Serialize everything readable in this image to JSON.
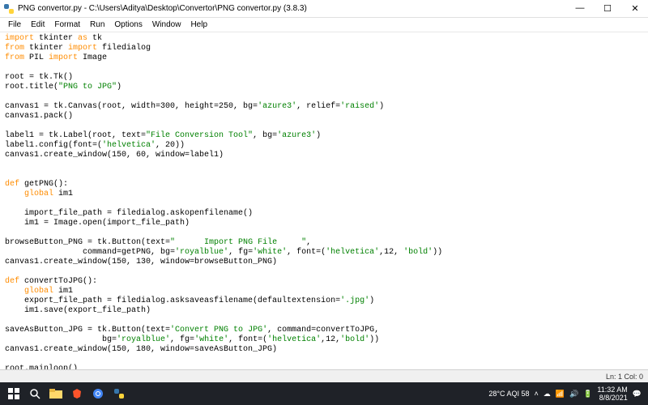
{
  "window": {
    "title": "PNG convertor.py - C:\\Users\\Aditya\\Desktop\\Convertor\\PNG convertor.py (3.8.3)"
  },
  "menu": {
    "file": "File",
    "edit": "Edit",
    "format": "Format",
    "run": "Run",
    "options": "Options",
    "window": "Window",
    "help": "Help"
  },
  "code": {
    "tokens": [
      {
        "t": "import",
        "c": "kw"
      },
      {
        "t": " tkinter "
      },
      {
        "t": "as",
        "c": "kw"
      },
      {
        "t": " tk\n"
      },
      {
        "t": "from",
        "c": "kw"
      },
      {
        "t": " tkinter "
      },
      {
        "t": "import",
        "c": "kw"
      },
      {
        "t": " filedialog\n"
      },
      {
        "t": "from",
        "c": "kw"
      },
      {
        "t": " PIL "
      },
      {
        "t": "import",
        "c": "kw"
      },
      {
        "t": " Image\n"
      },
      {
        "t": "\n"
      },
      {
        "t": "root = tk.Tk()\n"
      },
      {
        "t": "root.title("
      },
      {
        "t": "\"PNG to JPG\"",
        "c": "str"
      },
      {
        "t": ")\n"
      },
      {
        "t": "\n"
      },
      {
        "t": "canvas1 = tk.Canvas(root, width=300, height=250, bg="
      },
      {
        "t": "'azure3'",
        "c": "str"
      },
      {
        "t": ", relief="
      },
      {
        "t": "'raised'",
        "c": "str"
      },
      {
        "t": ")\n"
      },
      {
        "t": "canvas1.pack()\n"
      },
      {
        "t": "\n"
      },
      {
        "t": "label1 = tk.Label(root, text="
      },
      {
        "t": "\"File Conversion Tool\"",
        "c": "str"
      },
      {
        "t": ", bg="
      },
      {
        "t": "'azure3'",
        "c": "str"
      },
      {
        "t": ")\n"
      },
      {
        "t": "label1.config(font=("
      },
      {
        "t": "'helvetica'",
        "c": "str"
      },
      {
        "t": ", 20))\n"
      },
      {
        "t": "canvas1.create_window(150, 60, window=label1)\n"
      },
      {
        "t": "\n\n"
      },
      {
        "t": "def",
        "c": "kw"
      },
      {
        "t": " getPNG():\n"
      },
      {
        "t": "    "
      },
      {
        "t": "global",
        "c": "kw"
      },
      {
        "t": " im1\n"
      },
      {
        "t": "\n"
      },
      {
        "t": "    import_file_path = filedialog.askopenfilename()\n"
      },
      {
        "t": "    im1 = Image.open(import_file_path)\n"
      },
      {
        "t": "\n"
      },
      {
        "t": "browseButton_PNG = tk.Button(text="
      },
      {
        "t": "\"      Import PNG File     \"",
        "c": "str"
      },
      {
        "t": ",\n"
      },
      {
        "t": "                command=getPNG, bg="
      },
      {
        "t": "'royalblue'",
        "c": "str"
      },
      {
        "t": ", fg="
      },
      {
        "t": "'white'",
        "c": "str"
      },
      {
        "t": ", font=("
      },
      {
        "t": "'helvetica'",
        "c": "str"
      },
      {
        "t": ",12, "
      },
      {
        "t": "'bold'",
        "c": "str"
      },
      {
        "t": "))\n"
      },
      {
        "t": "canvas1.create_window(150, 130, window=browseButton_PNG)\n"
      },
      {
        "t": "\n"
      },
      {
        "t": "def",
        "c": "kw"
      },
      {
        "t": " convertToJPG():\n"
      },
      {
        "t": "    "
      },
      {
        "t": "global",
        "c": "kw"
      },
      {
        "t": " im1\n"
      },
      {
        "t": "    export_file_path = filedialog.asksaveasfilename(defaultextension="
      },
      {
        "t": "'.jpg'",
        "c": "str"
      },
      {
        "t": ")\n"
      },
      {
        "t": "    im1.save(export_file_path)\n"
      },
      {
        "t": "\n"
      },
      {
        "t": "saveAsButton_JPG = tk.Button(text="
      },
      {
        "t": "'Convert PNG to JPG'",
        "c": "str"
      },
      {
        "t": ", command=convertToJPG,\n"
      },
      {
        "t": "                    bg="
      },
      {
        "t": "'royalblue'",
        "c": "str"
      },
      {
        "t": ", fg="
      },
      {
        "t": "'white'",
        "c": "str"
      },
      {
        "t": ", font=("
      },
      {
        "t": "'helvetica'",
        "c": "str"
      },
      {
        "t": ",12,"
      },
      {
        "t": "'bold'",
        "c": "str"
      },
      {
        "t": "))\n"
      },
      {
        "t": "canvas1.create_window(150, 180, window=saveAsButton_JPG)\n"
      },
      {
        "t": "\n"
      },
      {
        "t": "root.mainloop()"
      }
    ]
  },
  "statusbar": {
    "position": "Ln: 1  Col: 0"
  },
  "tray": {
    "weather": "28°C  AQI 58",
    "time": "11:32 AM",
    "date": "8/8/2021"
  }
}
